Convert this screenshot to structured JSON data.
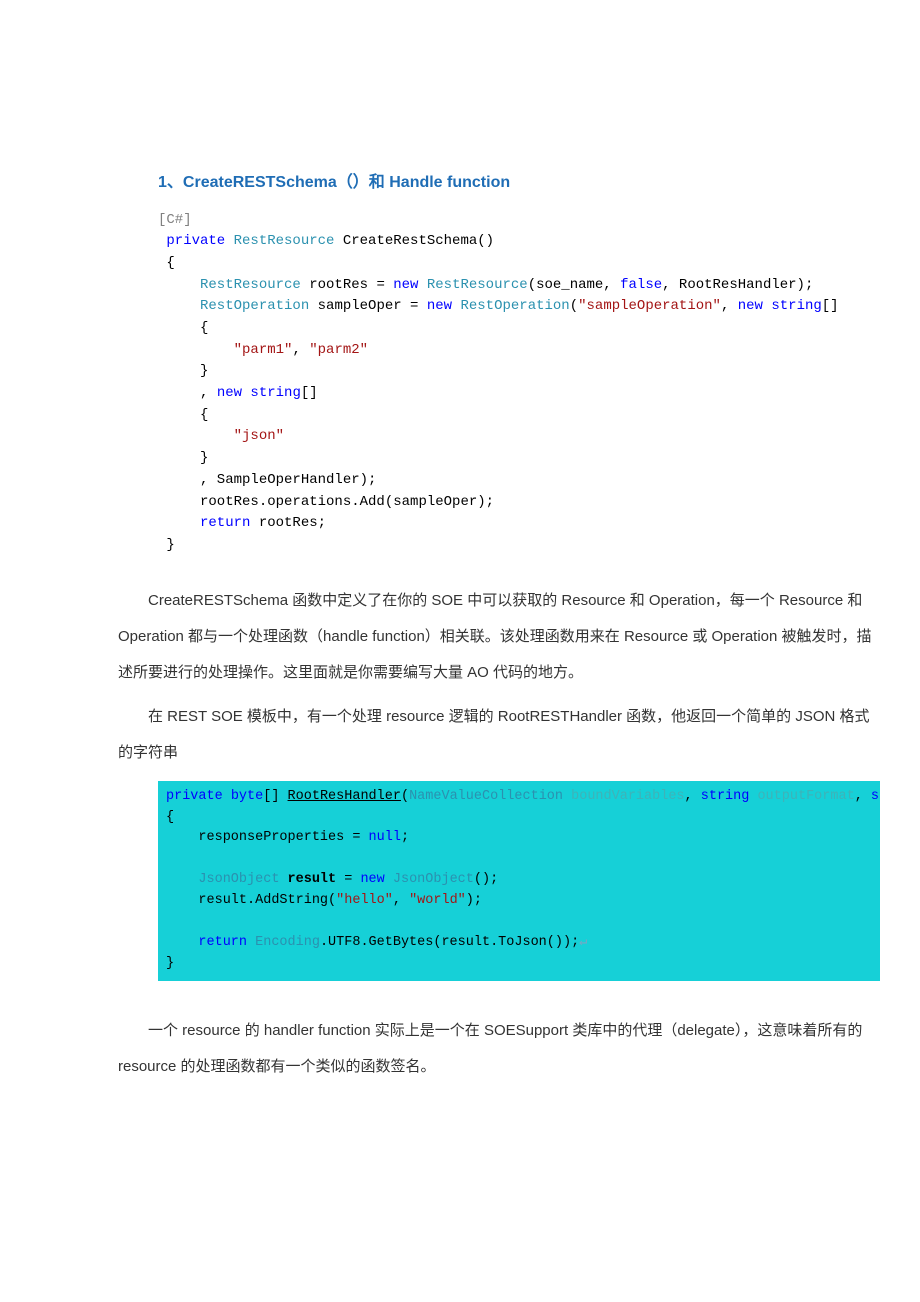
{
  "heading": {
    "num": "1",
    "sep": "、",
    "fn": "CreateRESTSchema",
    "paren": "（）",
    "and": "和 ",
    "hf": "Handle function"
  },
  "code1": {
    "l01_a": "[C#]",
    "l02_kw": " private",
    "l02_ty": " RestResource",
    "l02_pl": " CreateRestSchema()",
    "l03": " {",
    "l04_ty1": "     RestResource",
    "l04_pl1": " rootRes = ",
    "l04_kw": "new",
    "l04_ty2": " RestResource",
    "l04_pl2": "(soe_name, ",
    "l04_kw2": "false",
    "l04_pl3": ", RootResHandler);",
    "l05_ty1": "     RestOperation",
    "l05_pl1": " sampleOper = ",
    "l05_kw": "new",
    "l05_ty2": " RestOperation",
    "l05_pl2": "(",
    "l05_str": "\"sampleOperation\"",
    "l05_pl3": ", ",
    "l05_kw2": "new",
    "l05_kw3": " string",
    "l05_pl4": "[]",
    "l06": "     {",
    "l07_pad": "         ",
    "l07_s1": "\"parm1\"",
    "l07_com": ", ",
    "l07_s2": "\"parm2\"",
    "l08": "     }",
    "l09_pl": "     , ",
    "l09_kw": "new",
    "l09_kw2": " string",
    "l09_pl2": "[]",
    "l10": "     {",
    "l11_pad": "         ",
    "l11_s": "\"json\"",
    "l12": "     }",
    "l13": "     , SampleOperHandler);",
    "l14": "     rootRes.operations.Add(sampleOper);",
    "l15_kw": "     return",
    "l15_pl": " rootRes;",
    "l16": " }"
  },
  "para1": "CreateRESTSchema 函数中定义了在你的 SOE 中可以获取的 Resource 和 Operation，每一个 Resource 和 Operation 都与一个处理函数（handle function）相关联。该处理函数用来在 Resource 或 Operation 被触发时，描述所要进行的处理操作。这里面就是你需要编写大量 AO 代码的地方。",
  "para2": "在 REST SOE 模板中，有一个处理 resource 逻辑的 RootRESTHandler 函数，他返回一个简单的 JSON 格式的字符串",
  "code2": {
    "l1_kw": "private",
    "l1_ty": " byte",
    "l1_b1": "[] ",
    "l1_fn": "RootResHandler",
    "l1_p1": "(",
    "l1_ty2": "NameValueCollection",
    "l1_f1": " boundVariables",
    "l1_c1": ", ",
    "l1_kw2": "string",
    "l1_f2": " outputFormat",
    "l1_c2": ", ",
    "l1_kw3": "string",
    "l2": "{",
    "l3_a": "    responseProperties = ",
    "l3_n": "null",
    "l3_s": ";",
    "l5_ty": "    JsonObject",
    "l5_b1": " result",
    "l5_eq": " = ",
    "l5_kw": "new",
    "l5_ty2": " JsonObject",
    "l5_p": "();",
    "l6_a": "    result.AddString(",
    "l6_s1": "\"hello\"",
    "l6_c": ", ",
    "l6_s2": "\"world\"",
    "l6_e": ");",
    "l8_kw": "    return",
    "l8_ty": " Encoding",
    "l8_b1": ".UTF8.GetBytes(result.ToJson());",
    "l8_ar": "↵",
    "l9": "}"
  },
  "para3": "一个 resource 的 handler function 实际上是一个在 SOESupport 类库中的代理（delegate），这意味着所有的 resource 的处理函数都有一个类似的函数签名。"
}
